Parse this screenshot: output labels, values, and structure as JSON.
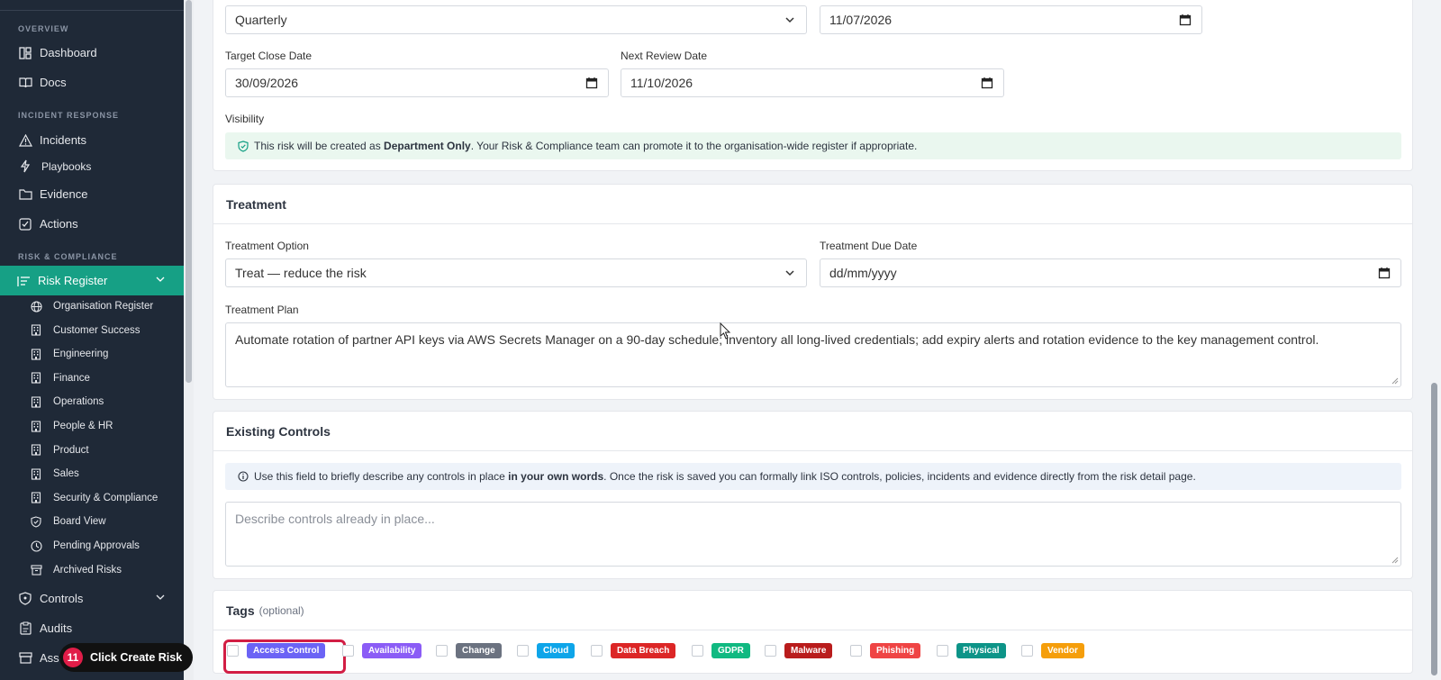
{
  "sidebar": {
    "sections": {
      "overview": "OVERVIEW",
      "incident_response": "INCIDENT RESPONSE",
      "risk_compliance": "RISK & COMPLIANCE"
    },
    "items": {
      "dashboard": "Dashboard",
      "docs": "Docs",
      "incidents": "Incidents",
      "playbooks": "Playbooks",
      "evidence": "Evidence",
      "actions": "Actions",
      "risk_register": "Risk Register",
      "controls": "Controls",
      "audits": "Audits",
      "assets": "Asse"
    },
    "sub_items": [
      {
        "label": "Organisation Register",
        "icon": "globe-icon"
      },
      {
        "label": "Customer Success",
        "icon": "building-icon"
      },
      {
        "label": "Engineering",
        "icon": "building-icon"
      },
      {
        "label": "Finance",
        "icon": "building-icon"
      },
      {
        "label": "Operations",
        "icon": "building-icon"
      },
      {
        "label": "People & HR",
        "icon": "building-icon"
      },
      {
        "label": "Product",
        "icon": "building-icon"
      },
      {
        "label": "Sales",
        "icon": "building-icon"
      },
      {
        "label": "Security & Compliance",
        "icon": "building-icon"
      },
      {
        "label": "Board View",
        "icon": "shield-icon"
      },
      {
        "label": "Pending Approvals",
        "icon": "clock-icon"
      },
      {
        "label": "Archived Risks",
        "icon": "archive-icon"
      }
    ]
  },
  "details": {
    "review_frequency_value": "Quarterly",
    "identified_date_value": "11/07/2026",
    "target_close_label": "Target Close Date",
    "target_close_value": "30/09/2026",
    "next_review_label": "Next Review Date",
    "next_review_value": "11/10/2026",
    "visibility_label": "Visibility",
    "visibility_pre": "This risk will be created as ",
    "visibility_bold": "Department Only",
    "visibility_post": ". Your Risk & Compliance team can promote it to the organisation-wide register if appropriate."
  },
  "treatment": {
    "title": "Treatment",
    "option_label": "Treatment Option",
    "option_value": "Treat — reduce the risk",
    "due_label": "Treatment Due Date",
    "due_value": "dd/mm/yyyy",
    "plan_label": "Treatment Plan",
    "plan_value": "Automate rotation of partner API keys via AWS Secrets Manager on a 90-day schedule; inventory all long-lived credentials; add expiry alerts and rotation evidence to the key management control."
  },
  "existing_controls": {
    "title": "Existing Controls",
    "info_pre": "Use this field to briefly describe any controls in place ",
    "info_bold": "in your own words",
    "info_post": ". Once the risk is saved you can formally link ISO controls, policies, incidents and evidence directly from the risk detail page.",
    "placeholder": "Describe controls already in place..."
  },
  "tags": {
    "title": "Tags",
    "optional": "(optional)",
    "items": [
      {
        "label": "Access Control",
        "color": "#6b63f5"
      },
      {
        "label": "Availability",
        "color": "#8b5cf6"
      },
      {
        "label": "Change",
        "color": "#6b7280"
      },
      {
        "label": "Cloud",
        "color": "#0ea5e9"
      },
      {
        "label": "Data Breach",
        "color": "#dc2626"
      },
      {
        "label": "GDPR",
        "color": "#10b981"
      },
      {
        "label": "Malware",
        "color": "#b91c1c"
      },
      {
        "label": "Phishing",
        "color": "#ef4444"
      },
      {
        "label": "Physical",
        "color": "#0d9488"
      },
      {
        "label": "Vendor",
        "color": "#f59e0b"
      }
    ]
  },
  "toast": {
    "step": "11",
    "pre": "Click ",
    "bold": "Create Risk"
  }
}
